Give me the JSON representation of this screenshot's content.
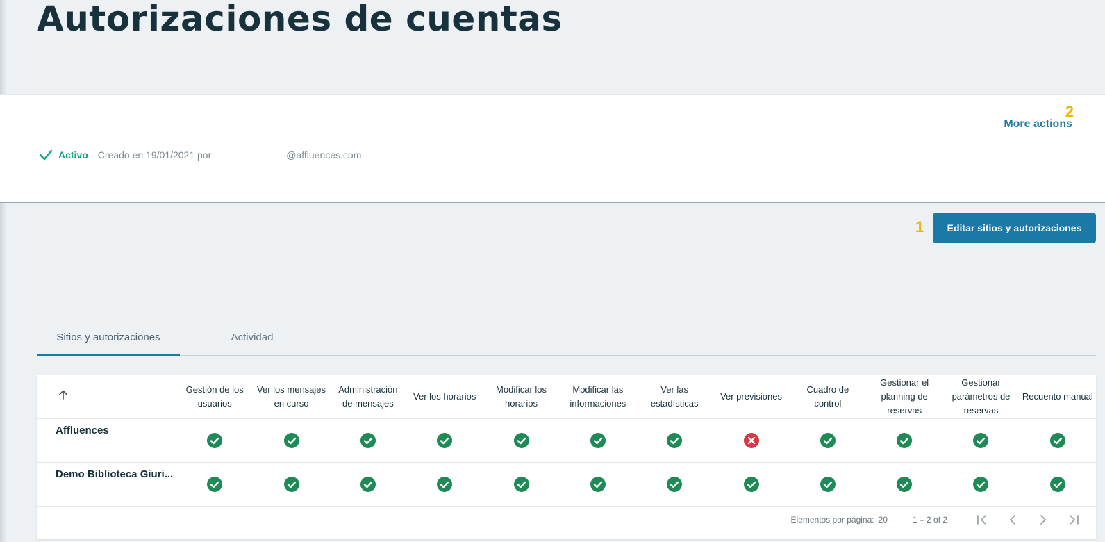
{
  "page": {
    "title": "Autorizaciones de cuentas"
  },
  "info": {
    "status": "Activo",
    "created": "Creado en 19/01/2021 por",
    "email": "@affluences.com",
    "more_actions": "More actions",
    "badge_more": "2"
  },
  "actions": {
    "edit_label": "Editar sitios y autorizaciones",
    "badge_edit": "1"
  },
  "tabs": [
    {
      "label": "Sitios y autorizaciones",
      "active": true
    },
    {
      "label": "Actividad",
      "active": false
    }
  ],
  "table": {
    "sort_icon": "arrow-up-icon",
    "columns": [
      "Gestión de los usuarios",
      "Ver los mensajes en curso",
      "Administración de mensajes",
      "Ver los horarios",
      "Modificar los horarios",
      "Modificar las informaciones",
      "Ver las estadísticas",
      "Ver previsiones",
      "Cuadro de control",
      "Gestionar el planning de reservas",
      "Gestionar parámetros de reservas",
      "Recuento manual"
    ],
    "rows": [
      {
        "name": "Affluences",
        "perms": [
          true,
          true,
          true,
          true,
          true,
          true,
          true,
          false,
          true,
          true,
          true,
          true
        ]
      },
      {
        "name": "Demo Biblioteca Giuri...",
        "perms": [
          true,
          true,
          true,
          true,
          true,
          true,
          true,
          true,
          true,
          true,
          true,
          true
        ]
      }
    ]
  },
  "pagination": {
    "per_page_label": "Elementos por página:",
    "per_page_value": "20",
    "range": "1 – 2 of 2"
  },
  "colors": {
    "accent": "#1b79a6",
    "allowed": "#1e8a56",
    "denied": "#dc3545",
    "active": "#11a37f"
  }
}
